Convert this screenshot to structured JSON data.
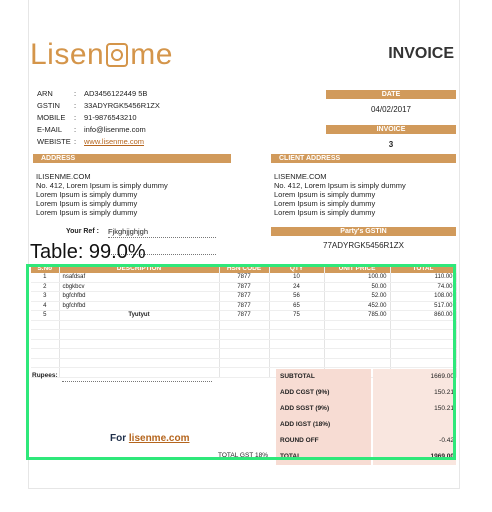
{
  "brand": {
    "logo_left": "Lisen",
    "logo_right": "me"
  },
  "invoice_title": "INVOICE",
  "company": {
    "arn_label": "ARN",
    "arn": "AD3456122449 5B",
    "gstin_label": "GSTIN",
    "gstin": "33ADYRGK5456R1ZX",
    "mobile_label": "MOBILE",
    "mobile": "91-9876543210",
    "email_label": "E-MAIL",
    "email": "info@lisenme.com",
    "website_label": "WEBISTE",
    "website": "www.lisenme.com"
  },
  "date": {
    "label": "DATE",
    "value": "04/02/2017"
  },
  "invoice": {
    "label": "INVOICE",
    "value": "3"
  },
  "address": {
    "label": "ADDRESS",
    "lines": [
      "ILISENME.COM",
      "No. 412, Lorem Ipsum is simply dummy",
      "Lorem Ipsum is simply dummy",
      "Lorem Ipsum is simply dummy",
      "Lorem Ipsum is simply dummy"
    ]
  },
  "client_address": {
    "label": "CLIENT ADDRESS",
    "lines": [
      "LISENME.COM",
      "No. 412, Lorem Ipsum is simply dummy",
      "Lorem Ipsum is simply dummy",
      "Lorem Ipsum is simply dummy",
      "Lorem Ipsum is simply dummy"
    ]
  },
  "your_ref": {
    "label": "Your Ref :",
    "value": "Fjkghjjghjgh"
  },
  "party_gstin": {
    "label": "Party's GSTIN",
    "value": "77ADYRGK5456R1ZX"
  },
  "overlay_label": "Table: 99.0%",
  "table": {
    "headers": [
      "S.No",
      "DESCRIPTION",
      "HSN CODE",
      "QTY",
      "UNIT PRICE",
      "TOTAL"
    ],
    "rows": [
      [
        "1",
        "nsafdsaf",
        "7877",
        "10",
        "100.00",
        "110.00"
      ],
      [
        "2",
        "cbgkbcv",
        "7877",
        "24",
        "50.00",
        "74.00"
      ],
      [
        "3",
        "bgfchfbd",
        "7877",
        "56",
        "52.00",
        "108.00"
      ],
      [
        "4",
        "bgfchfbd",
        "7877",
        "65",
        "452.00",
        "517.00"
      ],
      [
        "5",
        "Tyutyut",
        "7877",
        "75",
        "785.00",
        "860.00"
      ],
      [
        "",
        "",
        "",
        "",
        "",
        ""
      ],
      [
        "",
        "",
        "",
        "",
        "",
        ""
      ],
      [
        "",
        "",
        "",
        "",
        "",
        ""
      ],
      [
        "",
        "",
        "",
        "",
        "",
        ""
      ],
      [
        "",
        "",
        "",
        "",
        "",
        ""
      ],
      [
        "",
        "",
        "",
        "",
        "",
        ""
      ]
    ]
  },
  "rupees_label": "Rupees:",
  "for_text": "For",
  "for_link": "lisenme.com",
  "total_gst": "TOTAL GST 18%",
  "totals": [
    {
      "label": "SUBTOTAL",
      "value": "1669.00"
    },
    {
      "label": "ADD CGST (9%)",
      "value": "150.21"
    },
    {
      "label": "ADD SGST (9%)",
      "value": "150.21"
    },
    {
      "label": "ADD IGST (18%)",
      "value": ""
    },
    {
      "label": "ROUND OFF",
      "value": "-0.42"
    },
    {
      "label": "TOTAL",
      "value": "1969.00"
    }
  ]
}
